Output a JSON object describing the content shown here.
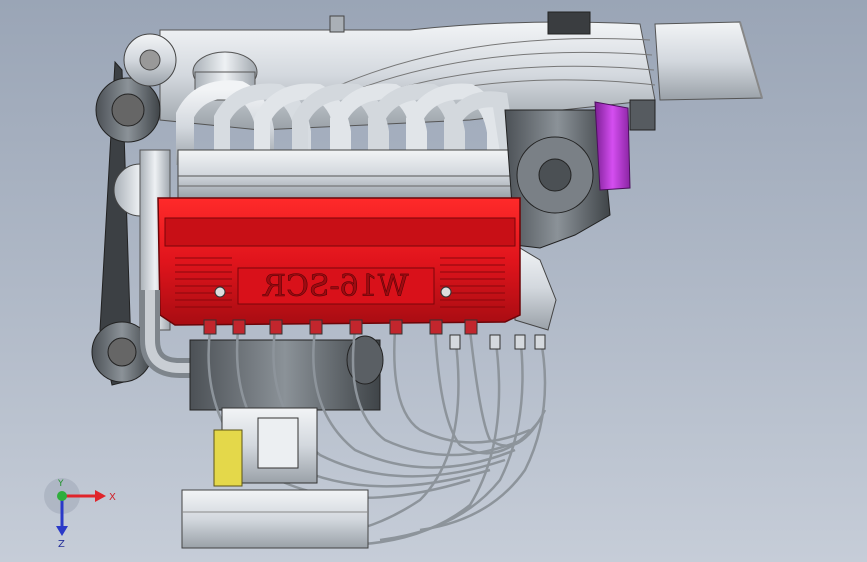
{
  "cad": {
    "engine_label": "W16-SCR",
    "triad": {
      "x_label": "X",
      "y_label": "Y",
      "z_label": "Z"
    }
  },
  "colors": {
    "background_top": "#9aa5b6",
    "background_bottom": "#c6cdd8",
    "valve_cover": "#e0141c",
    "valve_cover_dark": "#9a0a0e",
    "metal": "#d8dde3",
    "metal_dark": "#8f969d",
    "bracket": "#b52fd1",
    "axis_x": "#e0242a",
    "axis_y": "#2fae3c",
    "axis_z": "#2a39c8"
  }
}
